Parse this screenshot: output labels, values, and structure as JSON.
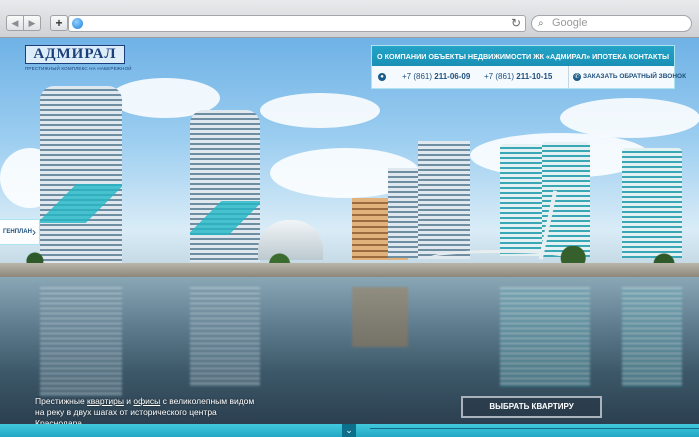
{
  "browser": {
    "back_icon": "◀",
    "forward_icon": "▶",
    "newtab_icon": "+",
    "reload_icon": "↻",
    "search_icon": "⌕",
    "search_placeholder": "Google"
  },
  "logo": {
    "name": "АДМИРАЛ",
    "tagline": "ПРЕСТИЖНЫЙ КОМПЛЕКС НА НАБЕРЕЖНОЙ"
  },
  "menu": {
    "items": [
      "О КОМПАНИИ",
      "ОБЪЕКТЫ НЕДВИЖИМОСТИ",
      "ЖК «АДМИРАЛ»",
      "ИПОТЕКА",
      "КОНТАКТЫ"
    ]
  },
  "contacts": {
    "phone1_prefix": "+7 (861)",
    "phone1_number": "211-06-09",
    "phone2_prefix": "+7 (861)",
    "phone2_number": "211-10-15",
    "callback_label": "ЗАКАЗАТЬ ОБРАТНЫЙ ЗВОНОК"
  },
  "genplan": {
    "label": "ГЕНПЛАН",
    "arrow": "›"
  },
  "hero": {
    "tagline_a": "Престижные ",
    "tagline_link1": "квартиры",
    "tagline_b": " и ",
    "tagline_link2": "офисы",
    "tagline_c": " с великолепным видом на реку в двух шагах от исторического центра Краснодара",
    "cta_label": "ВЫБРАТЬ КВАРТИРУ"
  },
  "footer": {
    "down_icon": "⌄"
  },
  "colors": {
    "accent": "#1a8fb5",
    "brand": "#1b3f7a",
    "strip": "#23a7c4"
  }
}
